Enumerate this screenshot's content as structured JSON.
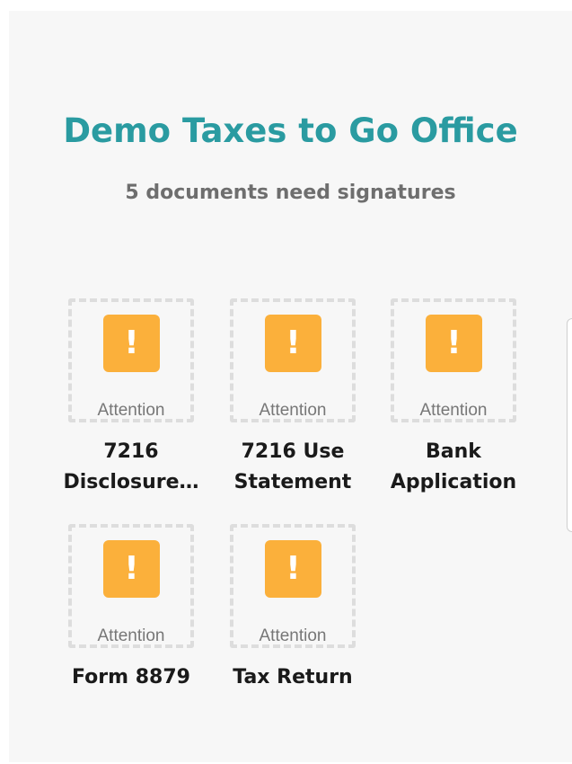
{
  "header": {
    "office_name": "Demo Taxes to Go Office",
    "pending_summary": "5 documents need signatures"
  },
  "documents": [
    {
      "name_line1": "7216",
      "name_line2": "Disclosure…",
      "status": "Attention",
      "icon": "exclamation-warning-icon"
    },
    {
      "name_line1": "7216 Use",
      "name_line2": "Statement",
      "status": "Attention",
      "icon": "exclamation-warning-icon"
    },
    {
      "name_line1": "Bank",
      "name_line2": "Application",
      "status": "Attention",
      "icon": "exclamation-warning-icon"
    },
    {
      "name_line1": "Form 8879",
      "name_line2": "",
      "status": "Attention",
      "icon": "exclamation-warning-icon"
    },
    {
      "name_line1": "Tax Return",
      "name_line2": "",
      "status": "Attention",
      "icon": "exclamation-warning-icon"
    }
  ],
  "glyphs": {
    "warning": "!"
  },
  "colors": {
    "title": "#2a9ba1",
    "subtitle": "#6e6e6e",
    "warning_badge": "#fbb03b",
    "thumb_border": "#dddddd",
    "background": "#f7f7f7"
  }
}
